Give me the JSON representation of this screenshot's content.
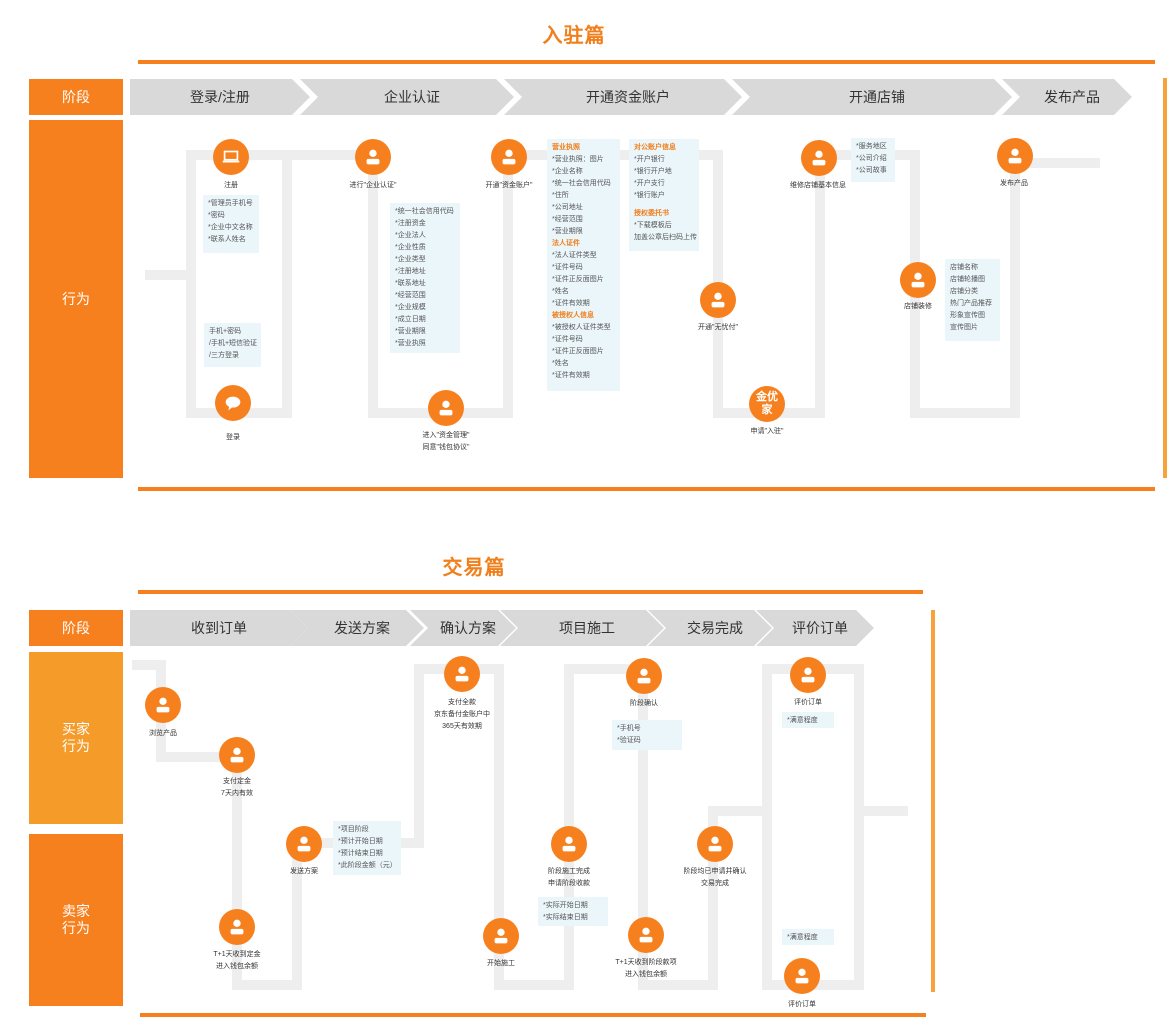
{
  "section1": {
    "title": "入驻篇",
    "stage_label": "阶段",
    "behavior_label": "行为",
    "stages": [
      "登录/注册",
      "企业认证",
      "开通资金账户",
      "开通店铺",
      "发布产品"
    ],
    "nodes": {
      "register": "注册",
      "login": "登录",
      "enterprise_cert": "进行\"企业认证\"",
      "enter_fund": [
        "进入\"资金管理\"",
        "同意\"钱包协议\""
      ],
      "open_fund": "开通\"资金账户\"",
      "open_wuyou": "开通\"无忧付\"",
      "apply_join": "申请\"入驻\"",
      "apply_badge": "金优家",
      "maintain_store": "维修店铺基本信息",
      "decorate_store": "店铺装修",
      "publish": "发布产品"
    },
    "boxes": {
      "register_fields": [
        "*管理员手机号",
        "*密码",
        "*企业中文名称",
        "*联系人姓名"
      ],
      "login_methods": [
        "手机+密码",
        "/手机+短信验证",
        "/三方登录"
      ],
      "cert_fields": [
        "*统一社会信用代码",
        "*注册资金",
        "*企业法人",
        "*企业性质",
        "*企业类型",
        "*注册地址",
        "*联系地址",
        "*经营范围",
        "*企业规模",
        "*成立日期",
        "*营业期限",
        "*营业执照"
      ],
      "fund_a": {
        "h1": "营业执照",
        "g1": [
          "*营业执照：图片",
          "*企业名称",
          "*统一社会信用代码",
          "*住所",
          "*公司地址",
          "*经营范围",
          "*营业期限"
        ],
        "h2": "法人证件",
        "g2": [
          "*法人证件类型",
          "*证件号码",
          "*证件正反面图片",
          "*姓名",
          "*证件有效期"
        ],
        "h3": "被授权人信息",
        "g3": [
          "*被授权人证件类型",
          "*证件号码",
          "*证件正反面图片",
          "*姓名",
          "*证件有效期"
        ]
      },
      "fund_b": {
        "h1": "对公账户信息",
        "g1": [
          "*开户银行",
          "*银行开户地",
          "*开户支行",
          "*银行账户"
        ],
        "h2": "授权委托书",
        "g2": [
          "*下载模板后",
          "加盖公章后扫码上传"
        ]
      },
      "store_info": [
        "*服务地区",
        "*公司介绍",
        "*公司故事"
      ],
      "decorate": [
        "店铺名称",
        "店铺轮播图",
        "店铺分类",
        "热门产品推荐",
        "形象宣传图",
        "宣传图片"
      ]
    }
  },
  "section2": {
    "title": "交易篇",
    "stage_label": "阶段",
    "buyer_label": [
      "买家",
      "行为"
    ],
    "seller_label": [
      "卖家",
      "行为"
    ],
    "stages": [
      "收到订单",
      "发送方案",
      "确认方案",
      "项目施工",
      "交易完成",
      "评价订单"
    ],
    "nodes": {
      "browse": "浏览产品",
      "pay_deposit": [
        "支付定金",
        "7天内有效"
      ],
      "receive_deposit": [
        "T+1天收到定金",
        "进入钱包余额"
      ],
      "send_plan": "发送方案",
      "pay_all": [
        "支付全款",
        "京东备付金账户中",
        "365天有效期"
      ],
      "start_build": "开始施工",
      "stage_done": [
        "阶段施工完成",
        "申请阶段收款"
      ],
      "stage_confirm": "阶段确认",
      "stage_payment": [
        "T+1天收到阶段款项",
        "进入钱包余额"
      ],
      "all_confirm": [
        "阶段均已申请并确认",
        "交易完成"
      ],
      "buyer_review": "评价订单",
      "seller_review": "评价订单"
    },
    "boxes": {
      "plan": [
        "*项目阶段",
        "*预计开始日期",
        "*预计结束日期",
        "*此阶段金额（元）"
      ],
      "actual": [
        "*实际开始日期",
        "*实际结束日期"
      ],
      "confirm": [
        "*手机号",
        "*验证码"
      ],
      "buyer_sat": [
        "*满意程度"
      ],
      "seller_sat": [
        "*满意程度"
      ]
    }
  }
}
